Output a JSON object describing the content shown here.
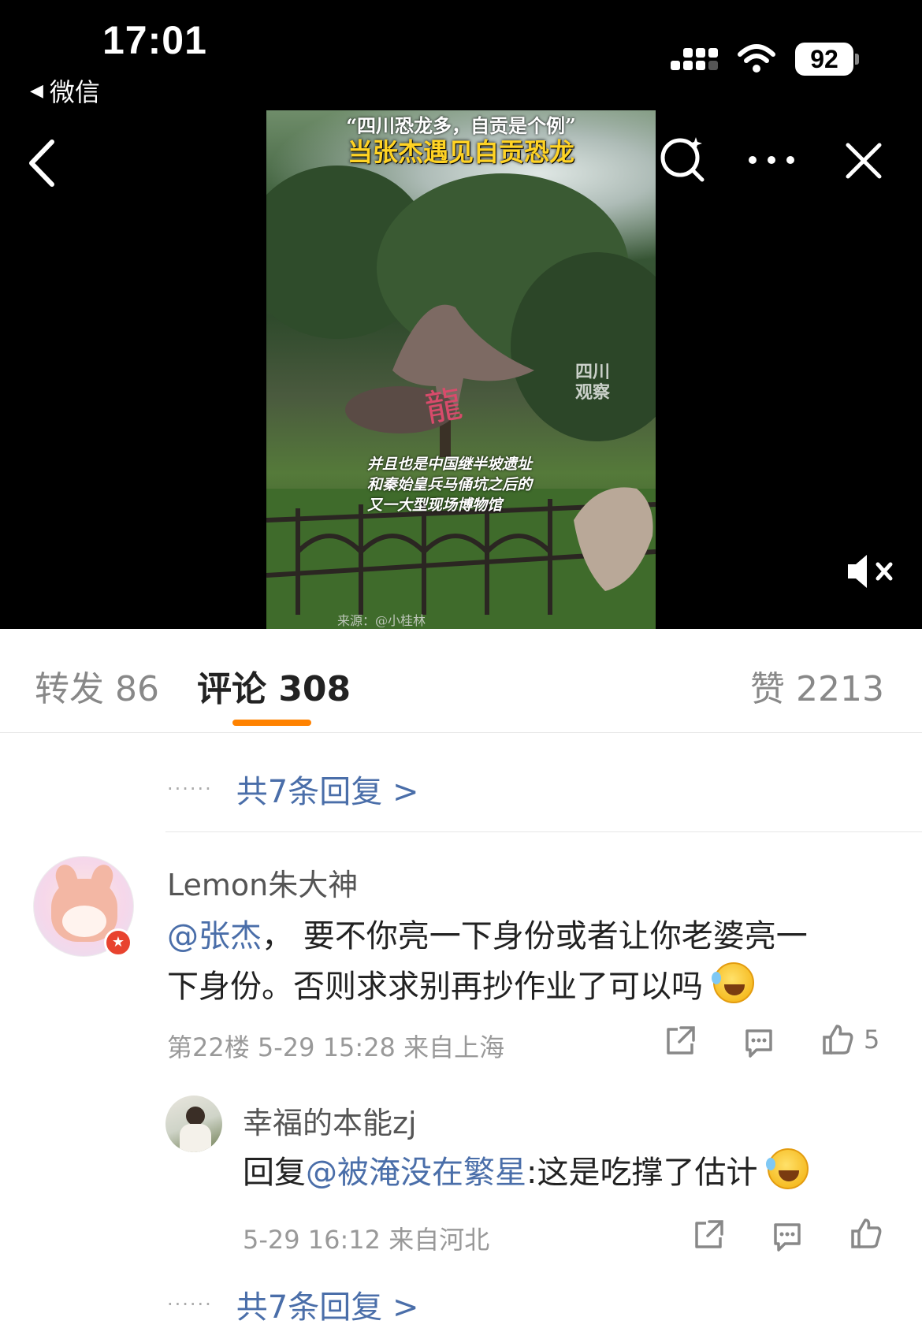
{
  "status_bar": {
    "time": "17:01",
    "back_app": "微信",
    "battery": "92"
  },
  "video": {
    "title_top": "“四川恐龙多，自贡是个例”",
    "title_main": "当张杰遇见自贡恐龙",
    "caption": [
      "并且也是中国继半坡遗址",
      "和秦始皇兵马俑坑之后的",
      "又一大型现场博物馆"
    ],
    "source": "来源：@小桂林",
    "watermark": [
      "四川",
      "观察"
    ]
  },
  "tabs": [
    {
      "label": "转发 86"
    },
    {
      "label": "评论 308"
    },
    {
      "label": "赞 2213"
    }
  ],
  "more_replies_label": "共7条回复 >",
  "more_replies_dots": "······",
  "comment": {
    "username": "Lemon朱大神",
    "mention": "@张杰",
    "text_line1_rest": "， 要不你亮一下身份或者让你老婆亮一",
    "text_line2": "下身份。否则求求别再抄作业了可以吗",
    "meta": "第22楼 5-29 15:28 来自上海",
    "like_count": "5"
  },
  "reply": {
    "username": "幸福的本能zj",
    "prefix": "回复",
    "mention": "@被淹没在繁星",
    "text": ":这是吃撑了估计",
    "meta": "5-29 16:12 来自河北"
  },
  "colors": {
    "accent": "#ff8200",
    "link": "#4a6ea9",
    "badge": "#e8432f"
  },
  "icons": [
    "back-chevron-icon",
    "search-sparkle-icon",
    "more-icon",
    "close-icon",
    "mute-icon",
    "share-icon",
    "comment-icon",
    "like-icon",
    "laugh-cry-emoji"
  ]
}
